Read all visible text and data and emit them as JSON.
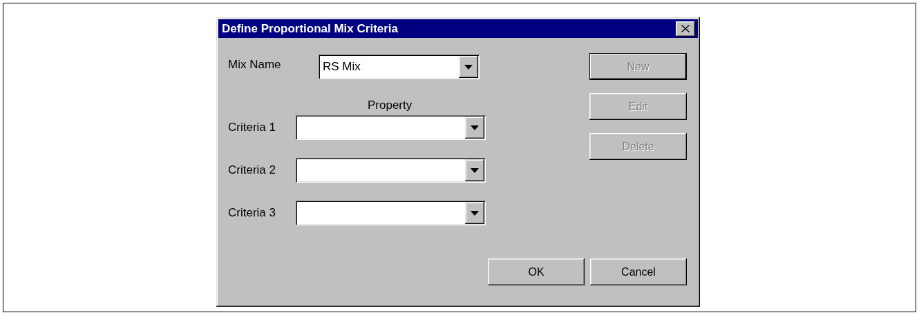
{
  "window": {
    "title": "Define Proportional Mix Criteria"
  },
  "mix_name": {
    "label": "Mix Name",
    "value": "RS Mix"
  },
  "property_heading": "Property",
  "criteria": [
    {
      "label": "Criteria 1"
    },
    {
      "label": "Criteria 2"
    },
    {
      "label": "Criteria 3"
    }
  ],
  "side_buttons": [
    {
      "label": "New",
      "disabled": true,
      "default": true
    },
    {
      "label": "Edit",
      "disabled": true,
      "default": false
    },
    {
      "label": "Delete",
      "disabled": true,
      "default": false
    }
  ],
  "buttons": [
    {
      "label": "OK"
    },
    {
      "label": "Cancel"
    }
  ]
}
